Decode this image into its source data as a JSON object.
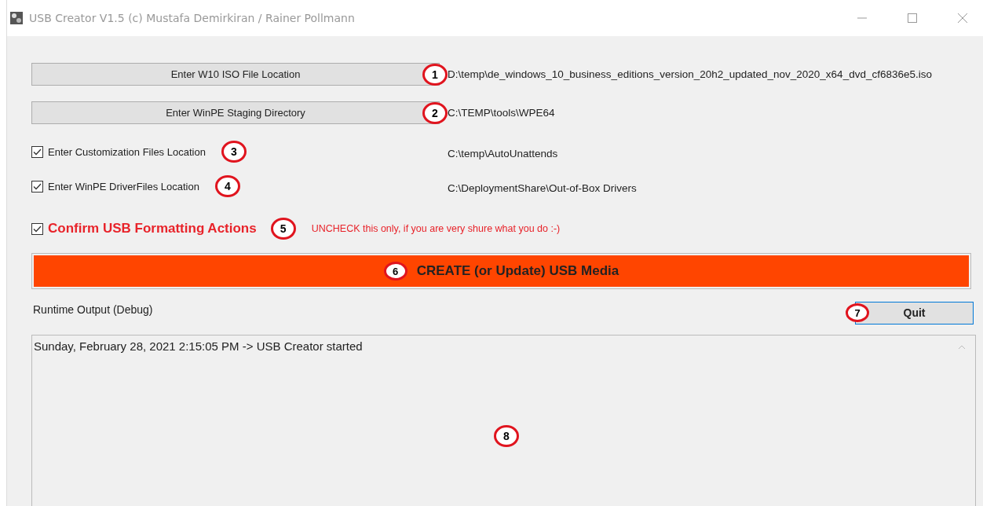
{
  "window": {
    "title": "USB Creator V1.5 (c) Mustafa Demirkiran / Rainer Pollmann"
  },
  "location_rows": [
    {
      "kind": "button",
      "label": "Enter W10 ISO File Location",
      "callout": "1",
      "path": "D:\\temp\\de_windows_10_business_editions_version_20h2_updated_nov_2020_x64_dvd_cf6836e5.iso"
    },
    {
      "kind": "button",
      "label": "Enter WinPE Staging Directory",
      "callout": "2",
      "path": "C:\\TEMP\\tools\\WPE64"
    },
    {
      "kind": "checkbox",
      "label": "Enter Customization Files Location",
      "checked": true,
      "callout": "3",
      "path": "C:\\temp\\AutoUnattends"
    },
    {
      "kind": "checkbox",
      "label": "Enter WinPE DriverFiles Location",
      "checked": true,
      "callout": "4",
      "path": "C:\\DeploymentShare\\Out-of-Box Drivers"
    }
  ],
  "confirm": {
    "label": "Confirm USB Formatting Actions",
    "checked": true,
    "callout": "5",
    "warning": "UNCHECK this only, if you are very shure what you do :-)"
  },
  "create_button": {
    "label": "CREATE (or Update) USB Media",
    "callout": "6"
  },
  "output_label": "Runtime Output (Debug)",
  "quit_button": {
    "label": "Quit",
    "callout": "7"
  },
  "output": {
    "lines": [
      "Sunday, February 28, 2021 2:15:05 PM -> USB Creator started"
    ],
    "callout": "8"
  }
}
